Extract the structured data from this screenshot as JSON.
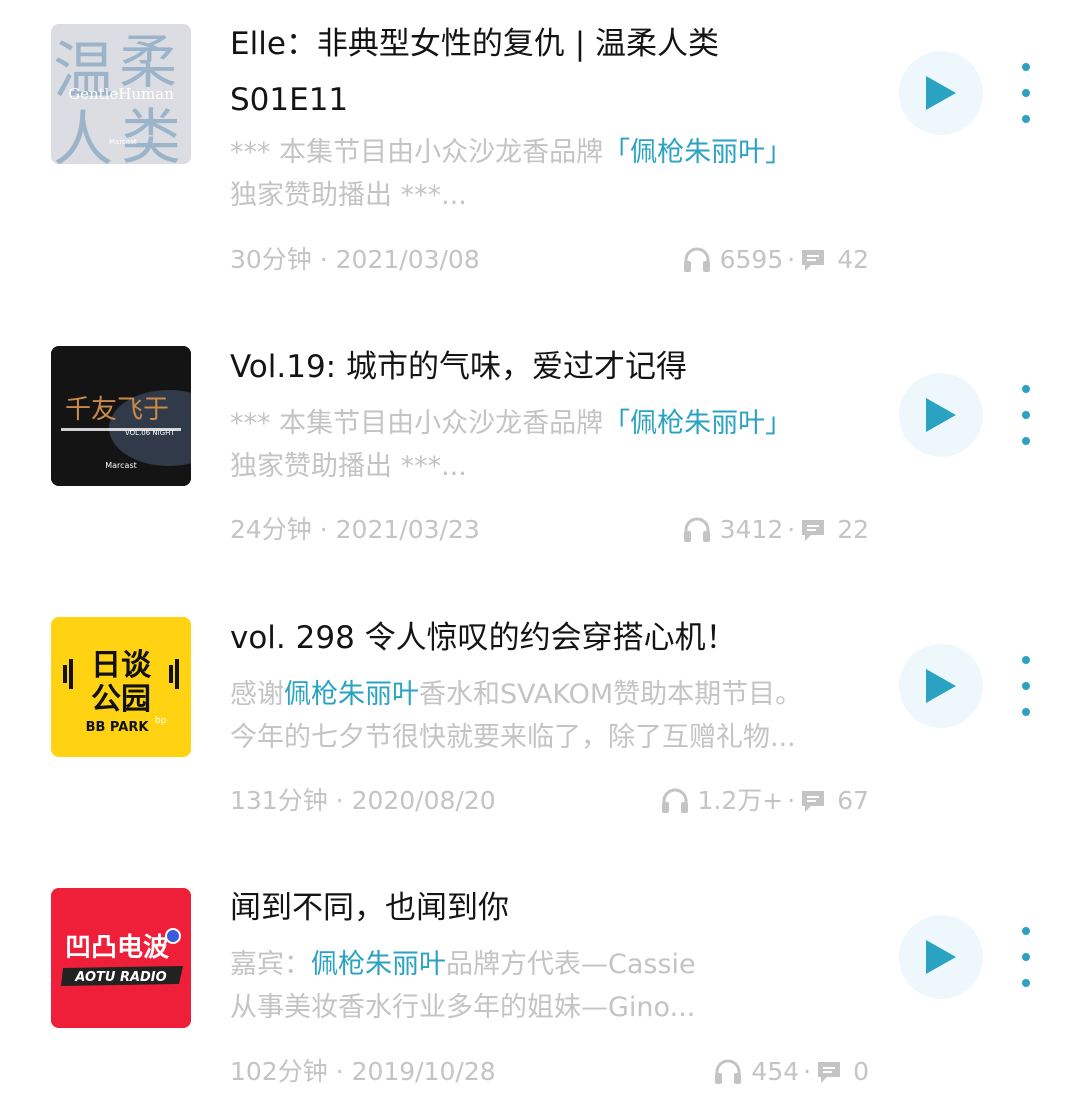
{
  "episodes": [
    {
      "cover": {
        "logo_text": "温柔人类",
        "sub_text": "GentleHuman",
        "brand": "Marcast",
        "colors": {
          "bg": "#dcdde2",
          "ink": "#9cb4c9"
        }
      },
      "title": "Elle：非典型女性的复仇 | 温柔人类 S01E11",
      "desc_line1_pre": "*** 本集节目由小众沙龙香品牌",
      "desc_line1_hl": "「佩枪朱丽叶」",
      "desc_line1_post": "",
      "desc_line2": "独家赞助播出 ***...",
      "duration": "30分钟",
      "date": "2021/03/08",
      "plays": "6595",
      "comments": "42"
    },
    {
      "cover": {
        "logo_text": "千友飞于",
        "sub_text": "VOL.06 NIGHT",
        "brand": "Marcast",
        "colors": {
          "bg": "#141414",
          "ink": "#c98a4a"
        }
      },
      "title": "Vol.19: 城市的气味，爱过才记得",
      "desc_line1_pre": "*** 本集节目由小众沙龙香品牌",
      "desc_line1_hl": "「佩枪朱丽叶」",
      "desc_line1_post": "",
      "desc_line2": "独家赞助播出 ***...",
      "duration": "24分钟",
      "date": "2021/03/23",
      "plays": "3412",
      "comments": "22"
    },
    {
      "cover": {
        "logo_line1": "日谈",
        "logo_line2": "公园",
        "sub_text": "BB PARK",
        "colors": {
          "bg": "#ffd212",
          "ink": "#111111"
        }
      },
      "title": "vol. 298 令人惊叹的约会穿搭心机！",
      "desc_line1_pre": "感谢",
      "desc_line1_hl": "佩枪朱丽叶",
      "desc_line1_post": "香水和SVAKOM赞助本期节目。",
      "desc_line2": "今年的七夕节很快就要来临了，除了互赠礼物...",
      "duration": "131分钟",
      "date": "2020/08/20",
      "plays": "1.2万+",
      "comments": "67"
    },
    {
      "cover": {
        "logo_text": "凹凸电波",
        "sub_text": "AOTU RADIO",
        "colors": {
          "bg": "#ef1f3a",
          "ink": "#ffffff"
        }
      },
      "title": "闻到不同，也闻到你",
      "desc_line1_pre": "嘉宾：",
      "desc_line1_hl": "佩枪朱丽叶",
      "desc_line1_post": "品牌方代表—Cassie",
      "desc_line2": "从事美妆香水行业多年的姐妹—Gino...",
      "duration": "102分钟",
      "date": "2019/10/28",
      "plays": "454",
      "comments": "0"
    }
  ],
  "meta_separator": " · ",
  "icons": {
    "play": "play-icon",
    "more": "more-vertical-icon",
    "plays": "headphones-icon",
    "comments": "comment-icon"
  },
  "colors": {
    "accent": "#2aa3c2",
    "play_bg": "#eef8fc",
    "muted": "#c4c4c4",
    "title": "#141414"
  }
}
